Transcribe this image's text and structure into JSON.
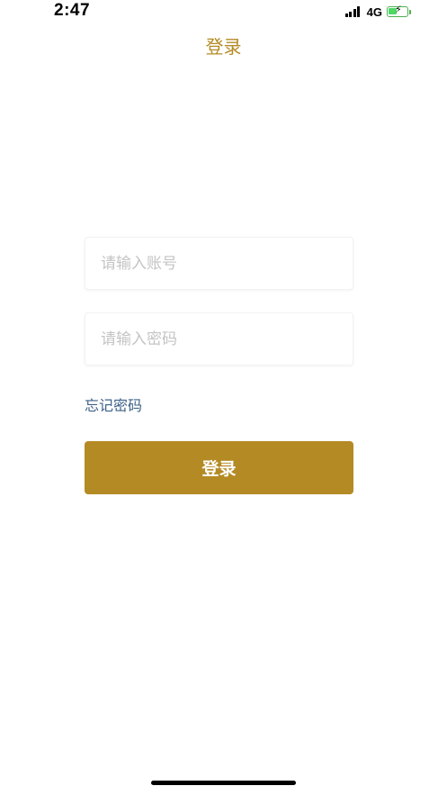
{
  "status_bar": {
    "time": "2:47",
    "network": "4G",
    "signal_icon": "signal-bars-icon",
    "battery_icon": "battery-charging-icon"
  },
  "nav": {
    "title": "登录"
  },
  "form": {
    "account_placeholder": "请输入账号",
    "account_value": "",
    "password_placeholder": "请输入密码",
    "password_value": "",
    "forgot_label": "忘记密码",
    "login_label": "登录"
  },
  "colors": {
    "accent": "#b48a24",
    "link": "#3e6289",
    "placeholder": "#c4c4c4",
    "battery": "#4cd964"
  }
}
